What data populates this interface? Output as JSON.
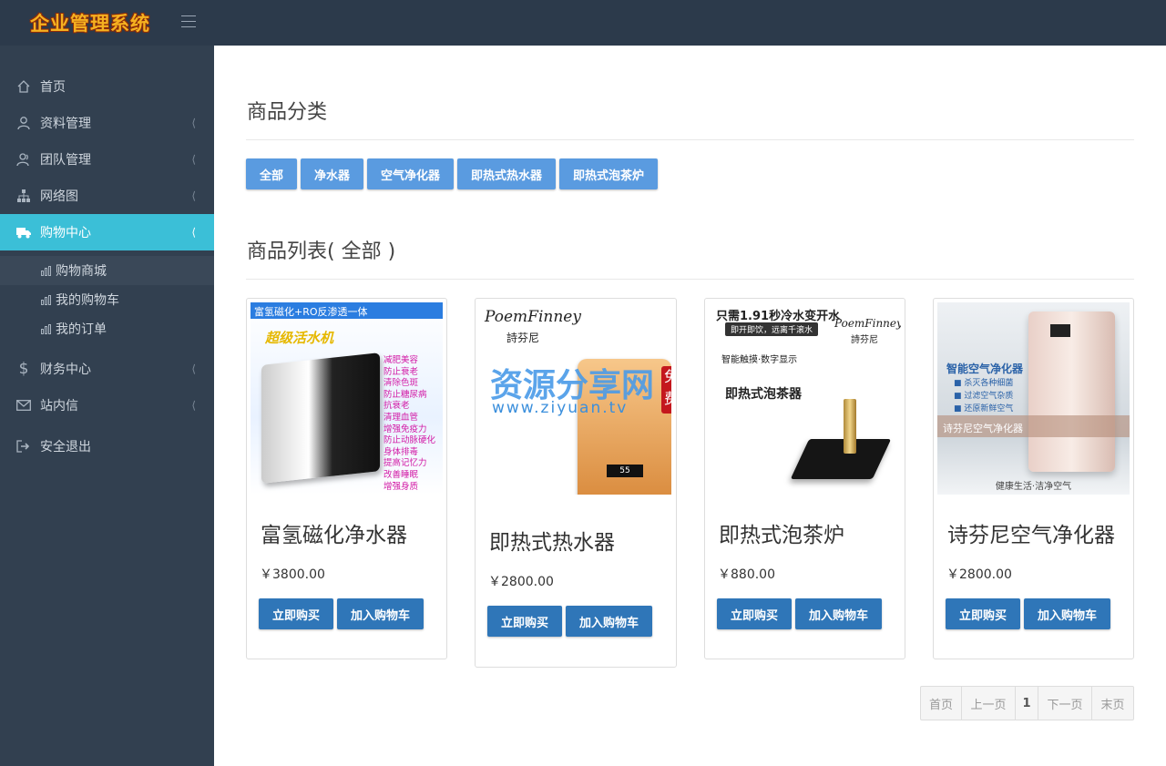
{
  "header": {
    "brand": "企业管理系统",
    "menu_icon": "hamburger-icon"
  },
  "sidebar": {
    "items": [
      {
        "label": "首页",
        "icon": "home-icon"
      },
      {
        "label": "资料管理",
        "icon": "user-icon"
      },
      {
        "label": "团队管理",
        "icon": "team-icon"
      },
      {
        "label": "网络图",
        "icon": "sitemap-icon"
      },
      {
        "label": "购物中心",
        "icon": "truck-icon"
      },
      {
        "label": "财务中心",
        "icon": "dollar-icon"
      },
      {
        "label": "站内信",
        "icon": "mail-icon"
      },
      {
        "label": "安全退出",
        "icon": "signout-icon"
      }
    ],
    "subitems": [
      {
        "label": "购物商城"
      },
      {
        "label": "我的购物车"
      },
      {
        "label": "我的订单"
      }
    ],
    "active_color": "#3bbfd7"
  },
  "main": {
    "category_title": "商品分类",
    "categories": [
      "全部",
      "净水器",
      "空气净化器",
      "即热式热水器",
      "即热式泡茶炉"
    ],
    "list_title": "商品列表( 全部 )",
    "products": [
      {
        "name": "富氢磁化净水器",
        "price": "￥3800.00",
        "buy": "立即购买",
        "cart": "加入购物车",
        "img_caption": "富氢磁化+RO反渗透一体",
        "img_title": "超级活水机",
        "img_list": [
          "减肥美容",
          "防止衰老",
          "清除色斑",
          "防止糖尿病",
          "抗衰老",
          "清理血管",
          "增强免疫力",
          "防止动脉硬化",
          "身体排毒",
          "提高记忆力",
          "改善睡眠",
          "增强身质"
        ]
      },
      {
        "name": "即热式热水器",
        "price": "￥2800.00",
        "buy": "立即购买",
        "cart": "加入购物车",
        "img_brand": "PoemFinney",
        "img_brand_cn": "詩芬尼",
        "img_display": "55",
        "watermark": "资源分享网",
        "watermark_url": "www.ziyuan.tv",
        "watermark_tag": "免费"
      },
      {
        "name": "即热式泡茶炉",
        "price": "￥880.00",
        "buy": "立即购买",
        "cart": "加入购物车",
        "img_headline": "只需1.91秒冷水变开水",
        "img_sub": "即开即饮，远离千滚水",
        "img_brand": "PoemFinney",
        "img_brand_cn": "詩芬尼",
        "img_feature": "智能触摸·数字显示",
        "img_title": "即热式泡茶器"
      },
      {
        "name": "诗芬尼空气净化器",
        "price": "￥2800.00",
        "buy": "立即购买",
        "cart": "加入购物车",
        "img_title": "智能空气净化器",
        "img_list": [
          "杀灭各种细菌",
          "过滤空气杂质",
          "还原新鲜空气"
        ],
        "img_band": "诗芬尼空气净化器",
        "img_footer": "健康生活·洁净空气"
      }
    ]
  },
  "pagination": {
    "first": "首页",
    "prev": "上一页",
    "current": "1",
    "next": "下一页",
    "last": "末页"
  }
}
